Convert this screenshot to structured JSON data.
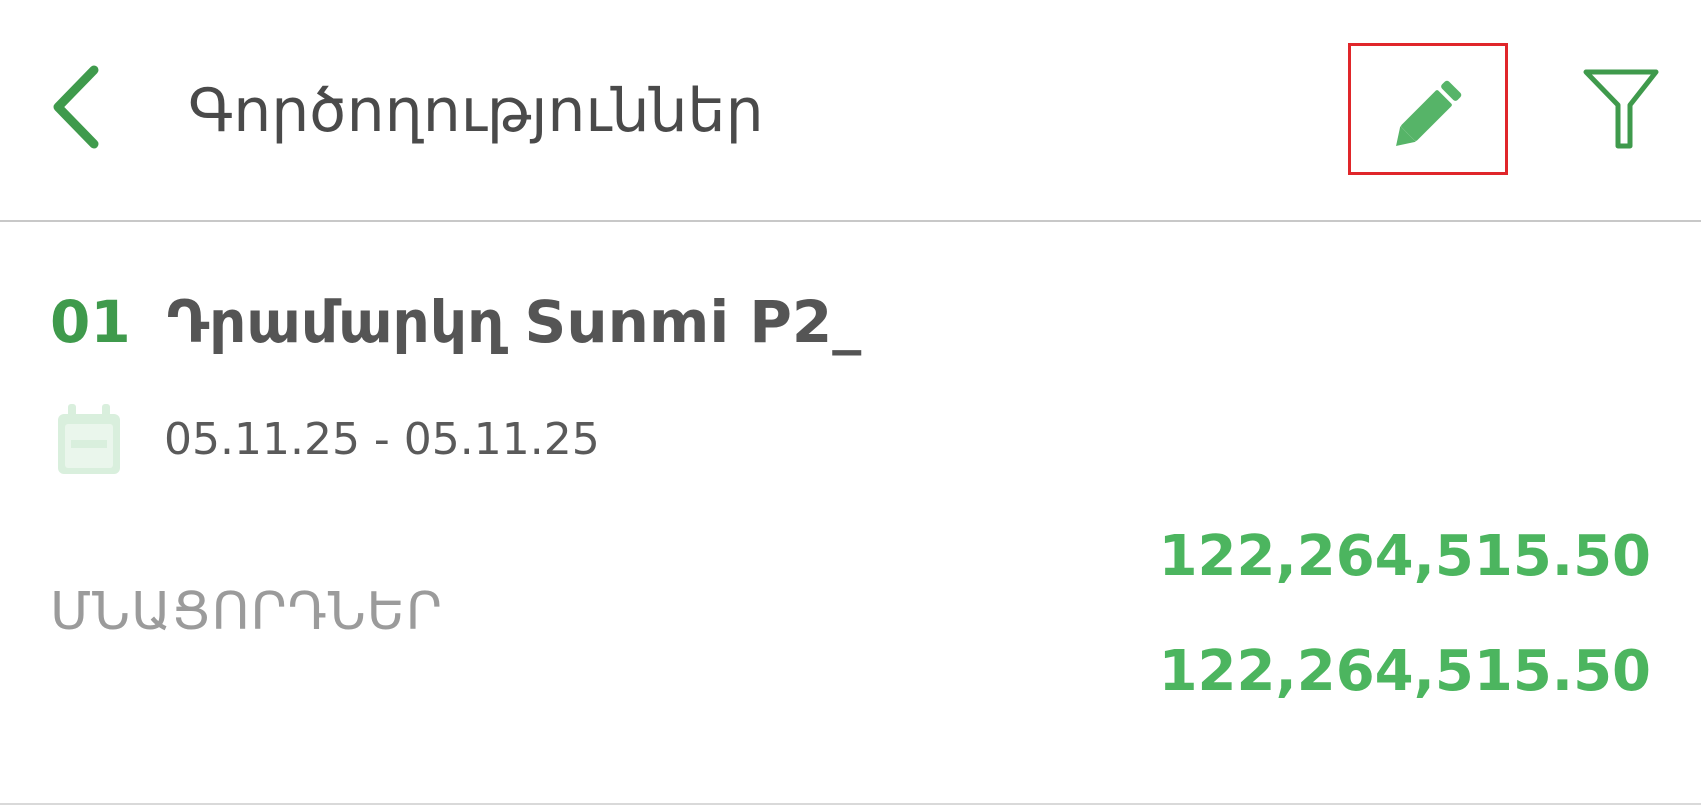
{
  "header": {
    "title": "Գործողություններ",
    "back_icon": "chevron-left-icon",
    "edit_icon": "pencil-icon",
    "filter_icon": "filter-icon"
  },
  "register": {
    "code": "01",
    "name": "Դրամարկղ Sunmi P2_",
    "date_range": "05.11.25 - 05.11.25",
    "calendar_icon": "calendar-icon"
  },
  "balances": {
    "label": "ՄՆԱՑՈՐԴՆԵՐ",
    "amounts": [
      "122,264,515.50",
      "122,264,515.50"
    ]
  },
  "colors": {
    "accent": "#3f9a4c",
    "amount": "#4cb55f",
    "highlight_border": "#e0262a",
    "calendar": "#d6eeda"
  }
}
